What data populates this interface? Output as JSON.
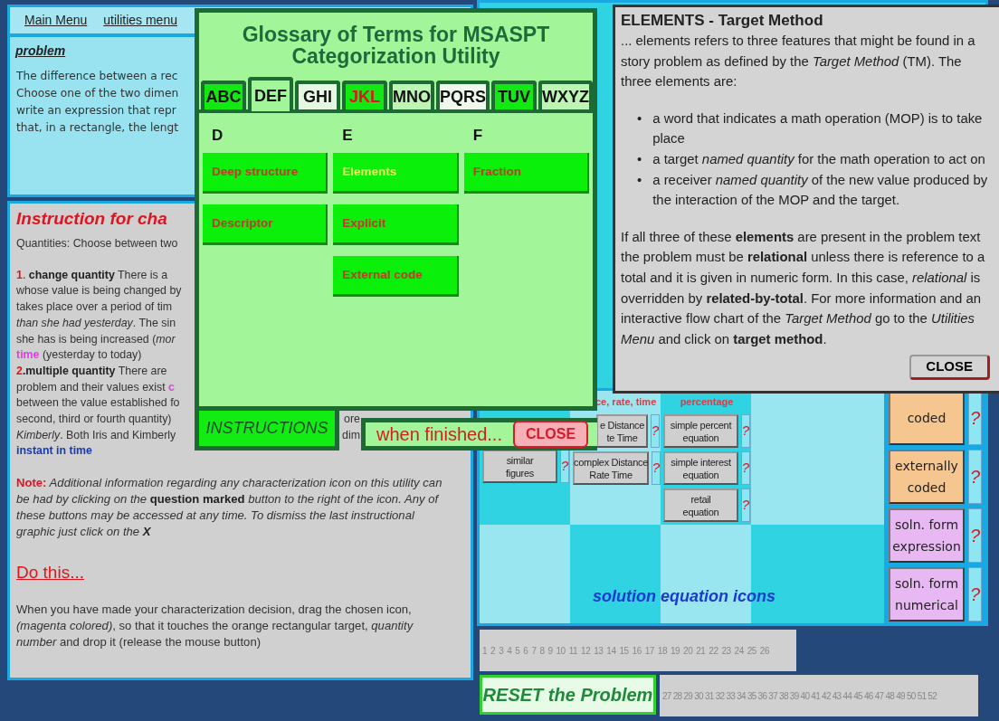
{
  "top_panel": {
    "menu": [
      "Main Menu",
      "utilities menu"
    ],
    "heading": "problem",
    "lines": [
      "The difference between a rec",
      "Choose one of the two dimen",
      "write an expression that repr",
      "that, in a rectangle, the lengt"
    ]
  },
  "instructions_panel": {
    "heading": "Instruction for cha",
    "sections": [
      {
        "kind": "lines",
        "lines": [
          [
            {
              "text": "Quantities: Choose between two",
              "kind": "plain"
            }
          ]
        ]
      },
      {
        "kind": "lines",
        "lines": [
          [
            {
              "text": "1",
              "kind": "num"
            },
            {
              "text": ". ",
              "kind": "plain"
            },
            {
              "text": "change quantity",
              "kind": "bold"
            },
            {
              "text": " There is a",
              "kind": "plain"
            }
          ],
          [
            {
              "text": "whose value is being changed by",
              "kind": "plain"
            }
          ],
          [
            {
              "text": "takes place over a period of tim",
              "kind": "plain"
            }
          ],
          [
            {
              "text": "than she had yesterday",
              "kind": "italic"
            },
            {
              "text": ". The sin",
              "kind": "plain"
            }
          ],
          [
            {
              "text": "she has is being increased (",
              "kind": "plain"
            },
            {
              "text": "mor",
              "kind": "italic"
            }
          ],
          [
            {
              "text": "time",
              "kind": "key"
            },
            {
              "text": " (yesterday to today)",
              "kind": "plain"
            }
          ],
          [
            {
              "text": "2",
              "kind": "num"
            },
            {
              "text": ".multiple quantity",
              "kind": "bold"
            },
            {
              "text": " There are",
              "kind": "plain"
            }
          ],
          [
            {
              "text": "problem and their values exist ",
              "kind": "plain"
            },
            {
              "text": "c",
              "kind": "key"
            }
          ],
          [
            {
              "text": "between the value established fo",
              "kind": "plain"
            }
          ],
          [
            {
              "text": "second, third or fourth quantity)",
              "kind": "plain"
            },
            {
              "text": "ore",
              "kind": "tail"
            }
          ],
          [
            {
              "text": "Kimberly",
              "kind": "italic"
            },
            {
              "text": ". Both Iris and Kimberly",
              "kind": "plain"
            },
            {
              "text": "dim",
              "kind": "tail"
            }
          ],
          [
            {
              "text": "instant in time",
              "kind": "term"
            }
          ]
        ]
      },
      {
        "kind": "paragraph",
        "lines": [
          [
            {
              "text": "Note:",
              "kind": "note"
            },
            {
              "text": " Additional information regarding any characterization icon on this utility can be had by clicking on the ",
              "kind": "italic"
            },
            {
              "text": "question marked",
              "kind": "bold"
            },
            {
              "text": " button to the right of the icon. Any of these buttons may be accessed at any time. To dismiss the last instructional graphic just click on the ",
              "kind": "italic"
            },
            {
              "text": "X",
              "kind": "bolditalic"
            }
          ]
        ]
      },
      {
        "kind": "link_heading",
        "text": "Do this..."
      },
      {
        "kind": "paragraph",
        "lines": [
          [
            {
              "text": "When you have made your characterization decision, drag the chosen icon, ",
              "kind": "plain"
            },
            {
              "text": "(magenta colored)",
              "kind": "italic"
            },
            {
              "text": ", so that it touches the orange rectangular target, ",
              "kind": "plain"
            },
            {
              "text": "quantity number",
              "kind": "italic"
            },
            {
              "text": " and drop it (release the mouse button)",
              "kind": "plain"
            }
          ]
        ]
      }
    ]
  },
  "icon_grid": {
    "columns": [
      {
        "icons": [
          {
            "lines": [
              "similar",
              "figures"
            ],
            "help": "?"
          }
        ]
      },
      {
        "header": "ce, rate, time",
        "icons": [
          {
            "lines": [
              "e Distance",
              "te Time"
            ],
            "help": "?"
          },
          {
            "lines": [
              "complex Distance",
              "Rate Time"
            ],
            "help": "?"
          }
        ]
      },
      {
        "header": "percentage",
        "icons": [
          {
            "lines": [
              "simple percent",
              "equation"
            ],
            "help": "?"
          },
          {
            "lines": [
              "simple interest",
              "equation"
            ],
            "help": "?"
          },
          {
            "lines": [
              "retail",
              "equation"
            ],
            "help": "?"
          }
        ]
      }
    ],
    "label": "solution equation icons"
  },
  "side_icons": [
    {
      "lines": [
        "coded"
      ],
      "color": "#f5c68f",
      "help": "?"
    },
    {
      "lines": [
        "externally",
        "coded"
      ],
      "color": "#f5c68f",
      "help": "?"
    },
    {
      "lines": [
        "soln. form",
        "expression"
      ],
      "color": "#e8b8f2",
      "help": "?"
    },
    {
      "lines": [
        "soln. form",
        "numerical"
      ],
      "color": "#e8b8f2",
      "help": "?"
    }
  ],
  "number_strips": [
    [
      "1",
      "2",
      "3",
      "4",
      "5",
      "6",
      "7",
      "8",
      "9",
      "10",
      "11",
      "12",
      "13",
      "14",
      "15",
      "16",
      "17",
      "18",
      "19",
      "20",
      "21",
      "22",
      "23",
      "24",
      "25",
      "26"
    ],
    [
      "27",
      "28",
      "29",
      "30",
      "31",
      "32",
      "33",
      "34",
      "35",
      "36",
      "37",
      "38",
      "39",
      "40",
      "41",
      "42",
      "43",
      "44",
      "45",
      "46",
      "47",
      "48",
      "49",
      "50",
      "51",
      "52"
    ]
  ],
  "reset_button": "RESET the Problem",
  "glossary": {
    "title": "Glossary of Terms for MSASPT Categorization Utility",
    "tabs": [
      {
        "label": "ABC",
        "selected": false,
        "color": "#12e812",
        "highlight": false
      },
      {
        "label": "DEF",
        "selected": true,
        "color": "#a3f59a",
        "highlight": false
      },
      {
        "label": "GHI",
        "selected": false,
        "color": "#e6f8e2",
        "highlight": false
      },
      {
        "label": "JKL",
        "selected": false,
        "color": "#12e812",
        "highlight": true
      },
      {
        "label": "MNO",
        "selected": false,
        "color": "#bdf5b4",
        "highlight": false
      },
      {
        "label": "PQRS",
        "selected": false,
        "color": "#eef9ec",
        "highlight": false
      },
      {
        "label": "TUV",
        "selected": false,
        "color": "#12e812",
        "highlight": false
      },
      {
        "label": "WXYZ",
        "selected": false,
        "color": "#bdf5b4",
        "highlight": false
      }
    ],
    "columns": [
      {
        "letter": "D",
        "terms": [
          {
            "label": "Deep structure",
            "selected": false
          },
          {
            "label": "Descriptor",
            "selected": false
          }
        ]
      },
      {
        "letter": "E",
        "terms": [
          {
            "label": "Elements",
            "selected": true
          },
          {
            "label": "Explicit",
            "selected": false
          },
          {
            "label": "External code",
            "selected": false
          }
        ]
      },
      {
        "letter": "F",
        "terms": [
          {
            "label": "Fraction",
            "selected": false
          }
        ]
      }
    ],
    "instructions_tab": "INSTRUCTIONS",
    "finished_text": "when finished...",
    "close_button": "CLOSE"
  },
  "elements_popup": {
    "title": "ELEMENTS - Target Method",
    "intro": "... elements refers to three features that might be found in a story problem as defined by the *Target Method* (TM). The three elements are:",
    "bullet_symbol": "•",
    "bullets": [
      "a word that indicates a math operation (MOP) is to take place",
      "a target *named quantity* for the math operation to act on",
      "a receiver *named quantity* of the new value produced by the interaction of the MOP and the target."
    ],
    "body": "If all three of these **elements** are present in the problem text the problem must be **relational** unless there is reference to a total and it is given in numeric form. In this case, *relational* is overridden by **related-by-total**. For more information and an interactive flow chart of the *Target Method* go to the *Utilities Menu* and click on **target method**.",
    "close_button": "CLOSE"
  }
}
